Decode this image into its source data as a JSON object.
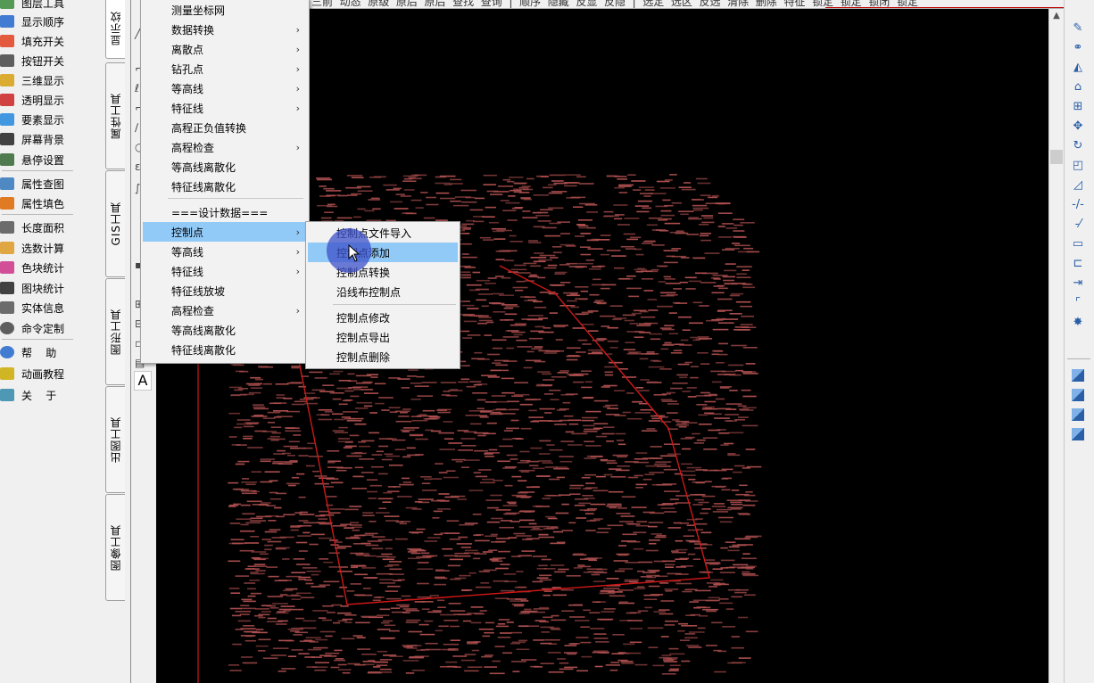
{
  "left_panel": {
    "items": [
      {
        "label": "图层工具",
        "icon": "layer-tool-icon",
        "color": "#3a8a3a"
      },
      {
        "label": "显示顺序",
        "icon": "display-order-icon",
        "color": "#2266cc"
      },
      {
        "label": "填充开关",
        "icon": "fill-toggle-icon",
        "color": "#e04020"
      },
      {
        "label": "按钮开关",
        "icon": "cad-button-icon",
        "color": "#444444"
      },
      {
        "label": "三维显示",
        "icon": "3d-display-icon",
        "color": "#d8a010"
      },
      {
        "label": "透明显示",
        "icon": "transparent-display-icon",
        "color": "#cc2222"
      },
      {
        "label": "要素显示",
        "icon": "feature-display-icon",
        "color": "#2288dd"
      },
      {
        "label": "屏幕背景",
        "icon": "screen-background-icon",
        "color": "#222222"
      },
      {
        "label": "悬停设置",
        "icon": "hover-settings-icon",
        "color": "#336633"
      },
      {
        "label": "属性查图",
        "icon": "magnifier-icon",
        "color": "#3377bb"
      },
      {
        "label": "属性填色",
        "icon": "fill-color-icon",
        "color": "#dd6600"
      },
      {
        "label": "长度面积",
        "icon": "length-area-icon",
        "color": "#555555"
      },
      {
        "label": "选数计算",
        "icon": "calculator-icon",
        "color": "#dd9922"
      },
      {
        "label": "色块统计",
        "icon": "color-block-stats-icon",
        "color": "#cc3388"
      },
      {
        "label": "图块统计",
        "icon": "block-stats-icon",
        "color": "#222222"
      },
      {
        "label": "实体信息",
        "icon": "entity-info-icon",
        "color": "#555555"
      },
      {
        "label": "命令定制",
        "icon": "gear-icon",
        "color": "#444444"
      },
      {
        "label": "帮    助",
        "icon": "help-icon",
        "color": "#2266cc"
      },
      {
        "label": "动画教程",
        "icon": "animation-tutorial-icon",
        "color": "#ccaa00"
      },
      {
        "label": "关    于",
        "icon": "about-icon",
        "color": "#3388aa"
      }
    ]
  },
  "vertical_tabs": [
    {
      "label": "显示纹"
    },
    {
      "label": "属性工具"
    },
    {
      "label": "GIS工具"
    },
    {
      "label": "图形工具"
    },
    {
      "label": "出图工具"
    },
    {
      "label": "图像工具"
    }
  ],
  "toolbar_top": {
    "text": "三前  动态  原级  原后  原后  查找  查询  |  顺序  隐藏  反显  反隐  |  选定  选区  反选  清除  删除  特征  锁定  锁定  锁闭  锁定"
  },
  "menu_main": {
    "items": [
      {
        "label": "测量坐标网",
        "has_submenu": false
      },
      {
        "label": "数据转换",
        "has_submenu": true
      },
      {
        "label": "离散点",
        "has_submenu": true
      },
      {
        "label": "钻孔点",
        "has_submenu": true
      },
      {
        "label": "等高线",
        "has_submenu": true
      },
      {
        "label": "特征线",
        "has_submenu": true
      },
      {
        "label": "高程正负值转换",
        "has_submenu": false
      },
      {
        "label": "高程检查",
        "has_submenu": true
      },
      {
        "label": "等高线离散化",
        "has_submenu": false
      },
      {
        "label": "特征线离散化",
        "has_submenu": false
      },
      {
        "label": "===设计数据===",
        "has_submenu": false
      },
      {
        "label": "控制点",
        "has_submenu": true,
        "highlighted": true
      },
      {
        "label": "等高线",
        "has_submenu": true
      },
      {
        "label": "特征线",
        "has_submenu": true
      },
      {
        "label": "特征线放坡",
        "has_submenu": false
      },
      {
        "label": "高程检查",
        "has_submenu": true
      },
      {
        "label": "等高线离散化",
        "has_submenu": false
      },
      {
        "label": "特征线离散化",
        "has_submenu": false
      }
    ]
  },
  "menu_sub": {
    "items": [
      {
        "label": "控制点文件导入"
      },
      {
        "label": "控制点添加",
        "highlighted": true
      },
      {
        "label": "控制点转换"
      },
      {
        "label": "沿线布控制点"
      },
      {
        "label": "控制点修改"
      },
      {
        "label": "控制点导出"
      },
      {
        "label": "控制点删除"
      }
    ]
  },
  "tool_column": {
    "text_button": "A"
  },
  "colors": {
    "canvas": "#000000",
    "point_labels": "#b05050",
    "boundary": "#d01818",
    "highlight": "#91c9f7"
  }
}
